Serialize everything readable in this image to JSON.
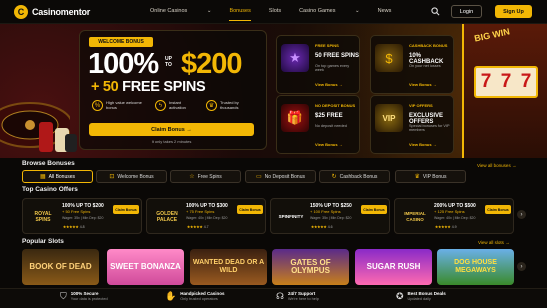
{
  "brand": {
    "logo_mark": "C",
    "name": "Casinomentor"
  },
  "nav": {
    "links": [
      "Online Casinos",
      "Bonuses",
      "Slots",
      "Casino Games",
      "News"
    ],
    "active": "Bonuses",
    "search_icon": "search-icon",
    "login_label": "Login",
    "signup_label": "Sign Up"
  },
  "hero": {
    "badge": "WELCOME BONUS",
    "percent": "100%",
    "up_to": "UP TO",
    "amount": "$200",
    "spins_plus": "+ 50",
    "spins_label": "FREE SPINS",
    "features": [
      {
        "icon": "percent-icon",
        "text": "High value welcome bonus"
      },
      {
        "icon": "bolt-icon",
        "text": "Instant activation"
      },
      {
        "icon": "trophy-icon",
        "text": "Trusted by thousands"
      }
    ],
    "claim_label": "Claim Bonus",
    "note": "It only takes 2 minutes",
    "slot_banner": "BIG WIN",
    "reels": [
      "7",
      "7",
      "7"
    ]
  },
  "promo_cards": [
    {
      "heading": "FREE SPINS",
      "main": "50 FREE SPINS",
      "sub": "On top games every week",
      "link": "View Bonus"
    },
    {
      "heading": "CASHBACK BONUS",
      "main": "10% CASHBACK",
      "sub": "On your net losses",
      "link": "View Bonus"
    },
    {
      "heading": "NO DEPOSIT BONUS",
      "main": "$25 FREE",
      "sub": "No deposit needed",
      "link": "View Bonus"
    },
    {
      "heading": "VIP OFFERS",
      "main": "EXCLUSIVE OFFERS",
      "sub": "Special bonuses for VIP members",
      "link": "View Bonus"
    }
  ],
  "browse": {
    "title": "Browse Bonuses",
    "view_all": "View all bonuses",
    "chips": [
      "All Bonuses",
      "Welcome Bonus",
      "Free Spins",
      "No Deposit Bonus",
      "Cashback Bonus",
      "VIP Bonus"
    ]
  },
  "offers": {
    "title": "Top Casino Offers",
    "items": [
      {
        "logo": "ROYAL SPINS",
        "bonus": "100% UP TO $200",
        "spins": "+ 50 Free Spins",
        "terms": "Wager: 35x  |  Min Dep: $20",
        "cta": "Claim Bonus",
        "rating": "4.8"
      },
      {
        "logo": "GOLDEN PALACE",
        "bonus": "100% UP TO $300",
        "spins": "+ 75 Free Spins",
        "terms": "Wager: 40x  |  Min Dep: $20",
        "cta": "Claim Bonus",
        "rating": "4.7"
      },
      {
        "logo": "SPINFINITY",
        "bonus": "150% UP TO $250",
        "spins": "+ 100 Free Spins",
        "terms": "Wager: 35x  |  Min Dep: $20",
        "cta": "Claim Bonus",
        "rating": "4.6"
      },
      {
        "logo": "IMPERIAL CASINO",
        "bonus": "200% UP TO $500",
        "spins": "+ 125 Free Spins",
        "terms": "Wager: 40x  |  Min Dep: $20",
        "cta": "Claim Bonus",
        "rating": "4.9"
      }
    ]
  },
  "slots": {
    "title": "Popular Slots",
    "view_all": "View all slots",
    "items": [
      "BOOK OF DEAD",
      "SWEET BONANZA",
      "WANTED DEAD OR A WILD",
      "GATES OF OLYMPUS",
      "SUGAR RUSH",
      "DOG HOUSE MEGAWAYS"
    ]
  },
  "footer": [
    {
      "icon": "shield-icon",
      "title": "100% Secure",
      "sub": "Your data is protected"
    },
    {
      "icon": "hand-icon",
      "title": "Handpicked Casinos",
      "sub": "Only trusted operators"
    },
    {
      "icon": "headset-icon",
      "title": "24/7 Support",
      "sub": "We're here to help"
    },
    {
      "icon": "medal-icon",
      "title": "Best Bonus Deals",
      "sub": "Updated daily"
    }
  ],
  "colors": {
    "accent": "#f2b705",
    "background": "#0a0806"
  }
}
